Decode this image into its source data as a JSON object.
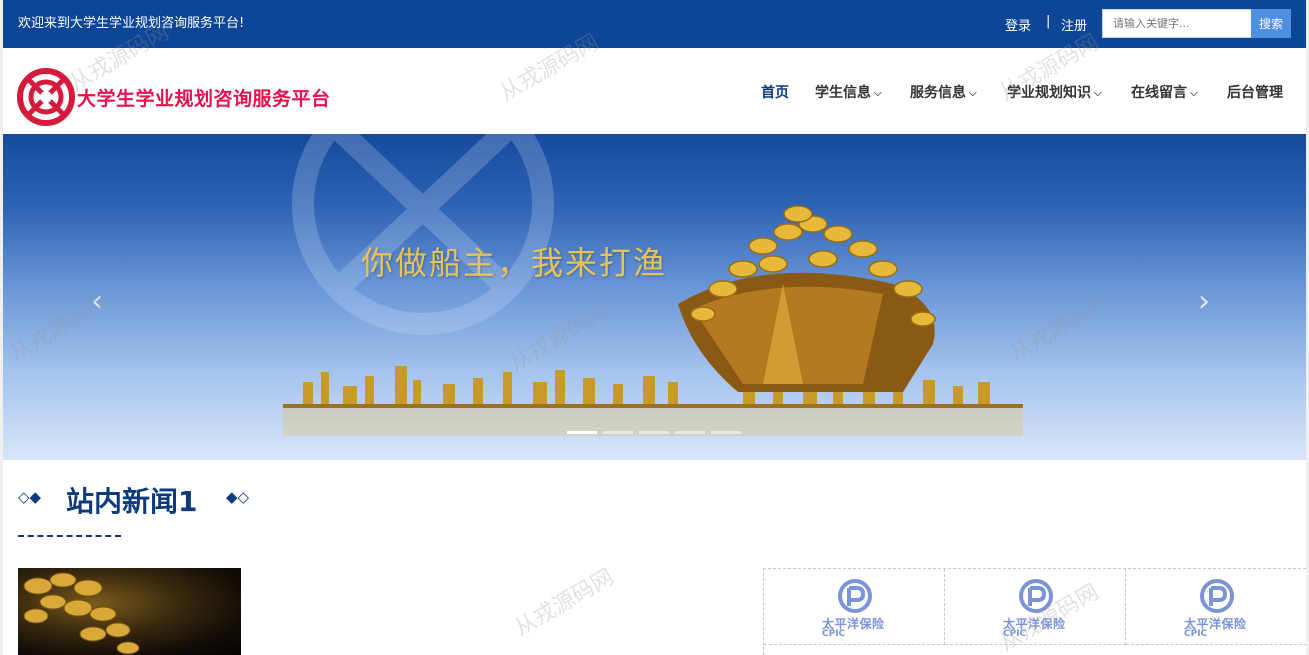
{
  "topbar": {
    "welcome": "欢迎来到大学生学业规划咨询服务平台!",
    "login": "登录",
    "separator": "|",
    "register": "注册",
    "search_placeholder": "请输入关键字...",
    "search_button": "搜索"
  },
  "header": {
    "brand": "大学生学业规划咨询服务平台",
    "nav": [
      {
        "label": "首页",
        "dropdown": false,
        "active": true
      },
      {
        "label": "学生信息",
        "dropdown": true,
        "active": false
      },
      {
        "label": "服务信息",
        "dropdown": true,
        "active": false
      },
      {
        "label": "学业规划知识",
        "dropdown": true,
        "active": false
      },
      {
        "label": "在线留言",
        "dropdown": true,
        "active": false
      },
      {
        "label": "后台管理",
        "dropdown": false,
        "active": false
      }
    ]
  },
  "banner": {
    "slogan": "你做船主，我来打渔",
    "prev_icon": "chevron-left-icon",
    "next_icon": "chevron-right-icon",
    "slide_count": 5,
    "active_slide": 1
  },
  "section": {
    "title": "站内新闻1",
    "left_ornament": "◇◆",
    "right_ornament": "◆◇"
  },
  "partners": [
    {
      "name_cn": "太平洋保险",
      "name_en": "CPIC"
    },
    {
      "name_cn": "太平洋保险",
      "name_en": "CPIC"
    },
    {
      "name_cn": "太平洋保险",
      "name_en": "CPIC"
    }
  ],
  "watermark": "从戎源码网",
  "colors": {
    "primary": "#0d4696",
    "brand_red": "#e4124d",
    "search_button": "#4f8fe0",
    "partner_blue": "#7b93d8"
  }
}
